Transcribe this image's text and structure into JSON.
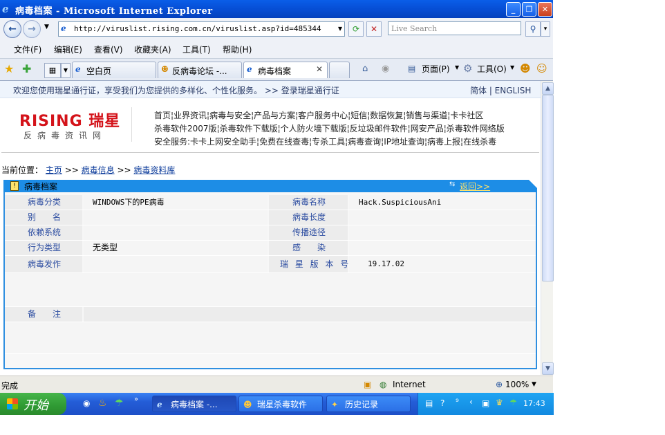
{
  "window": {
    "title": "病毒档案 - Microsoft Internet Explorer",
    "address": "http://viruslist.rising.com.cn/viruslist.asp?id=485344",
    "search_placeholder": "Live Search"
  },
  "menu": [
    "文件(F)",
    "编辑(E)",
    "查看(V)",
    "收藏夹(A)",
    "工具(T)",
    "帮助(H)"
  ],
  "tabs": [
    {
      "label": "空白页"
    },
    {
      "label": "反病毒论坛 -..."
    },
    {
      "label": "病毒档案"
    }
  ],
  "toolbar_right": {
    "page": "页面(P)",
    "tools": "工具(O)"
  },
  "page": {
    "welcome": "欢迎您使用瑞星通行证，享受我们为您提供的多样化、个性化服务。 >> 登录瑞星通行证",
    "lang": "简体 | ENGLISH",
    "logo": "RISING 瑞星",
    "logo_sub": "反病毒资讯网",
    "nav_line1": "首页¦业界资讯¦病毒与安全¦产品与方案¦客户服务中心¦短信¦数据恢复¦销售与渠道¦卡卡社区",
    "nav_line2": "杀毒软件2007版¦杀毒软件下载版¦个人防火墙下载版¦反垃圾邮件软件¦网安产品¦杀毒软件网络版",
    "nav_line3": "安全服务:卡卡上网安全助手¦免费在线查毒¦专杀工具¦病毒查询¦IP地址查询¦病毒上报¦在线杀毒",
    "breadcrumb_prefix": "当前位置：",
    "breadcrumb": [
      "主页",
      "病毒信息",
      "病毒资料库"
    ],
    "breadcrumb_sep": ">>"
  },
  "panel": {
    "title": "病毒档案",
    "back": "返回>>",
    "rows": [
      {
        "l1": "病毒分类",
        "v1": "WINDOWS下的PE病毒",
        "l2": "病毒名称",
        "v2": "Hack.SuspiciousAni"
      },
      {
        "l1": "别　　名",
        "v1": "",
        "l2": "病毒长度",
        "v2": ""
      },
      {
        "l1": "依赖系统",
        "v1": "",
        "l2": "传播途径",
        "v2": ""
      },
      {
        "l1": "行为类型",
        "v1": "无类型",
        "l2": "感　　染",
        "v2": ""
      },
      {
        "l1": "病毒发作",
        "v1": "",
        "l2": "瑞 星 版 本 号",
        "v2": "19.17.02"
      }
    ],
    "note_label": "备　　注"
  },
  "status": {
    "text": "完成",
    "zone": "Internet",
    "zoom": "100%"
  },
  "taskbar": {
    "start": "开始",
    "tasks": [
      "病毒档案 -...",
      "瑞星杀毒软件",
      "历史记录"
    ],
    "clock": "17:43"
  }
}
